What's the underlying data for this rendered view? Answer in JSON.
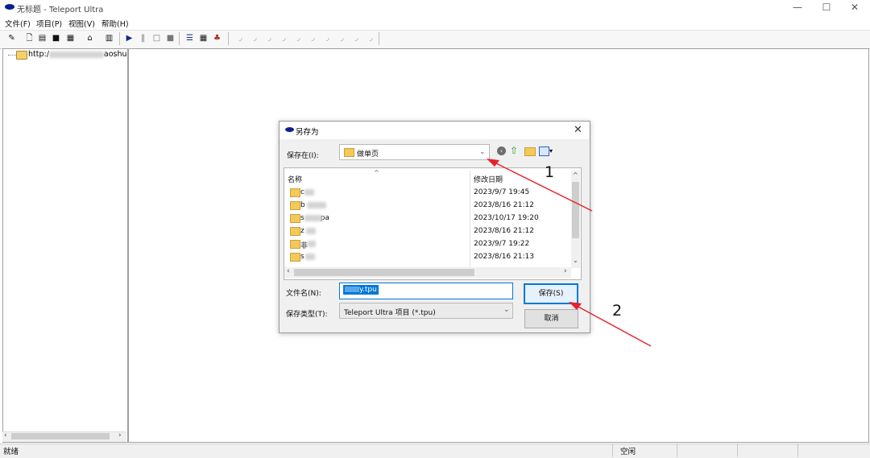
{
  "window": {
    "title": "无标题 - Teleport Ultra",
    "controls": {
      "minimize": "—",
      "maximize": "☐",
      "close": "✕"
    }
  },
  "menu": [
    "文件(F)",
    "项目(P)",
    "视图(V)",
    "帮助(H)"
  ],
  "tree": {
    "item_prefix": "http:/",
    "item_suffix": "aoshu"
  },
  "status": {
    "left": "就绪",
    "middle": "空闲"
  },
  "dialog": {
    "title": "另存为",
    "close": "✕",
    "save_in_label": "保存在(I):",
    "save_in_value": "做单页",
    "columns": {
      "name": "名称",
      "modified": "修改日期"
    },
    "files": [
      {
        "name": "c",
        "date": "2023/9/7 19:45"
      },
      {
        "name": "b",
        "date": "2023/8/16 21:12"
      },
      {
        "name": "s       pa",
        "date": "2023/10/17 19:20"
      },
      {
        "name": "z",
        "date": "2023/8/16 21:12"
      },
      {
        "name": "非",
        "date": "2023/9/7 19:22"
      },
      {
        "name": "s",
        "date": "2023/8/16 21:13"
      }
    ],
    "filename_label": "文件名(N):",
    "filename_value": "y.tpu",
    "filetype_label": "保存类型(T):",
    "filetype_value": "Teleport Ultra 项目 (*.tpu)",
    "save_button": "保存(S)",
    "cancel_button": "取消"
  },
  "annotations": {
    "arrow1_number": "1",
    "arrow2_number": "2",
    "color": "#e8202a"
  }
}
